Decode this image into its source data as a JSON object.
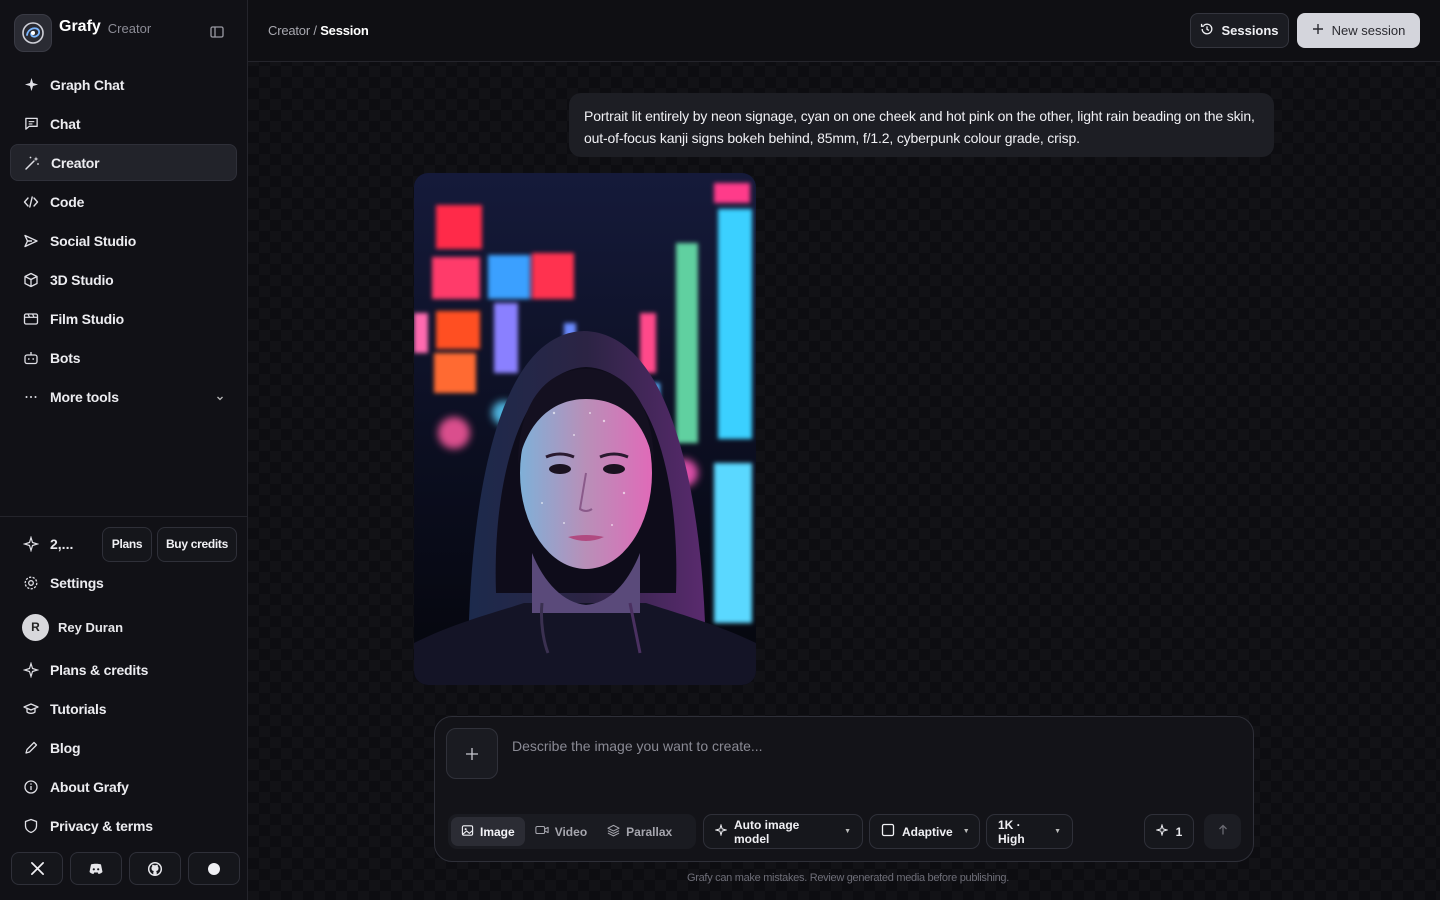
{
  "brand": {
    "name": "Grafy",
    "sub": "Creator",
    "logo_icon": "spiral-logo"
  },
  "nav": [
    {
      "label": "Graph Chat",
      "icon": "sparkle-icon"
    },
    {
      "label": "Chat",
      "icon": "message-icon"
    },
    {
      "label": "Creator",
      "icon": "wand-icon",
      "active": true
    },
    {
      "label": "Code",
      "icon": "code-icon"
    },
    {
      "label": "Social Studio",
      "icon": "send-icon"
    },
    {
      "label": "3D Studio",
      "icon": "cube-icon"
    },
    {
      "label": "Film Studio",
      "icon": "film-icon"
    },
    {
      "label": "Bots",
      "icon": "bot-icon"
    },
    {
      "label": "More tools",
      "icon": "ellipsis-icon"
    }
  ],
  "credits": {
    "value": "2,...",
    "plans_label": "Plans",
    "buy_label": "Buy credits"
  },
  "lower_nav": {
    "settings": "Settings",
    "user": {
      "initial": "R",
      "name": "Rey Duran"
    },
    "plans_credits": "Plans & credits",
    "tutorials": "Tutorials",
    "blog": "Blog",
    "about": "About Grafy",
    "privacy": "Privacy & terms"
  },
  "social": [
    "x-icon",
    "discord-icon",
    "github-icon",
    "circle-icon"
  ],
  "header": {
    "crumb_parent": "Creator",
    "crumb_sep": " / ",
    "crumb_current": "Session",
    "sessions_label": "Sessions",
    "new_session_label": "New session"
  },
  "prompt": {
    "text": "Portrait lit entirely by neon signage, cyan on one cheek and hot pink on the other, light rain beading on the skin, out-of-focus kanji signs bokeh behind, 85mm, f/1.2, cyberpunk colour grade, crisp."
  },
  "composer": {
    "placeholder": "Describe the image you want to create...",
    "modes": [
      {
        "label": "Image",
        "active": true
      },
      {
        "label": "Video"
      },
      {
        "label": "Parallax"
      }
    ],
    "model_label": "Auto image model",
    "aspect_label": "Adaptive",
    "quality_label": "1K · High",
    "count": "1"
  },
  "disclaimer": "Grafy can make mistakes. Review generated media before publishing."
}
